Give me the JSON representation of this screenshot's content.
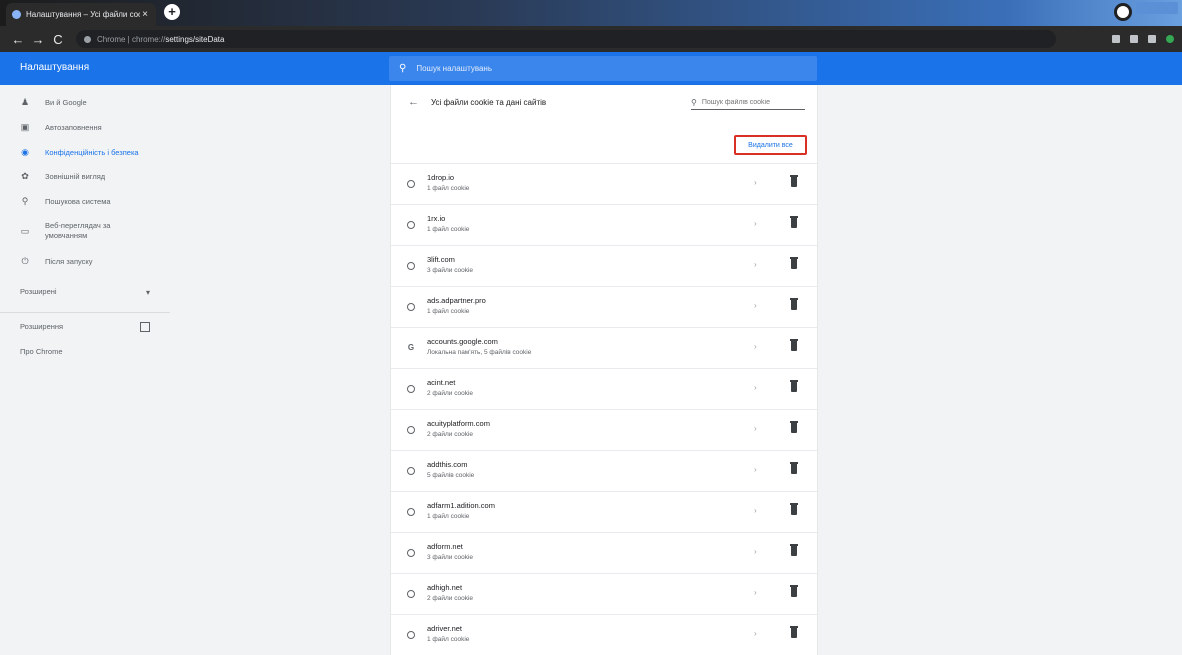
{
  "browser": {
    "tab_title": "Налаштування – Усі файли cookie",
    "new_tab_symbol": "+",
    "close_symbol": "×",
    "url_host": "Chrome | chrome://",
    "url_path": "settings/siteData",
    "nav": {
      "back": "←",
      "forward": "→",
      "reload": "C"
    }
  },
  "header": {
    "title": "Налаштування",
    "search_placeholder": "Пошук налаштувань"
  },
  "sidebar": {
    "items": [
      {
        "label": "Ви й Google",
        "icon": "person-icon",
        "glyph": "♟"
      },
      {
        "label": "Автозаповнення",
        "icon": "autofill-icon",
        "glyph": "▣"
      },
      {
        "label": "Конфіденційність і безпека",
        "icon": "shield-icon",
        "glyph": "◉",
        "active": true
      },
      {
        "label": "Зовнішній вигляд",
        "icon": "palette-icon",
        "glyph": "✿"
      },
      {
        "label": "Пошукова система",
        "icon": "search-icon",
        "glyph": "⚲"
      },
      {
        "label": "Веб-переглядач за умовчанням",
        "icon": "browser-icon",
        "glyph": "▭"
      },
      {
        "label": "Після запуску",
        "icon": "power-icon",
        "glyph": "⏻"
      }
    ],
    "advanced": "Розширені",
    "extensions": "Розширення",
    "about": "Про Chrome"
  },
  "content": {
    "page_title": "Усі файли cookie та дані сайтів",
    "cookie_search_placeholder": "Пошук файлів cookie",
    "remove_all": "Видалити все",
    "sites": [
      {
        "name": "1drop.io",
        "count": "1 файл cookie",
        "favicon": "globe"
      },
      {
        "name": "1rx.io",
        "count": "1 файл cookie",
        "favicon": "globe"
      },
      {
        "name": "3lift.com",
        "count": "3 файли cookie",
        "favicon": "globe"
      },
      {
        "name": "ads.adpartner.pro",
        "count": "1 файл cookie",
        "favicon": "globe"
      },
      {
        "name": "accounts.google.com",
        "count": "Локальна пам'ять, 5 файлів cookie",
        "favicon": "google"
      },
      {
        "name": "acint.net",
        "count": "2 файли cookie",
        "favicon": "globe"
      },
      {
        "name": "acuityplatform.com",
        "count": "2 файли cookie",
        "favicon": "globe"
      },
      {
        "name": "addthis.com",
        "count": "5 файлів cookie",
        "favicon": "globe"
      },
      {
        "name": "adfarm1.adition.com",
        "count": "1 файл cookie",
        "favicon": "globe"
      },
      {
        "name": "adform.net",
        "count": "3 файли cookie",
        "favicon": "globe"
      },
      {
        "name": "adhigh.net",
        "count": "2 файли cookie",
        "favicon": "globe"
      },
      {
        "name": "adriver.net",
        "count": "1 файл cookie",
        "favicon": "globe"
      }
    ]
  },
  "colors": {
    "accent": "#1a73e8",
    "highlight_border": "#d93025"
  }
}
